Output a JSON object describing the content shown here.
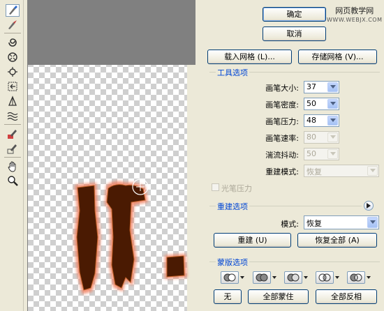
{
  "buttons": {
    "ok": "确定",
    "cancel": "取消",
    "load_mesh": "载入网格 (L)...",
    "save_mesh": "存储网格 (V)...",
    "reconstruct": "重建 (U)",
    "restore_all": "恢复全部 (A)",
    "none": "无",
    "mask_all": "全部蒙住",
    "invert_all": "全部反相"
  },
  "tool_options": {
    "title": "工具选项",
    "brush_size_label": "画笔大小:",
    "brush_size": "37",
    "brush_density_label": "画笔密度:",
    "brush_density": "50",
    "brush_pressure_label": "画笔压力:",
    "brush_pressure": "48",
    "brush_rate_label": "画笔速率:",
    "brush_rate": "80",
    "turbulent_jitter_label": "湍流抖动:",
    "turbulent_jitter": "50",
    "reconstruct_mode_label": "重建模式:",
    "reconstruct_mode": "恢复",
    "stylus_pressure_label": "光笔压力"
  },
  "reconstruct_options": {
    "title": "重建选项",
    "mode_label": "模式:",
    "mode": "恢复"
  },
  "mask_options": {
    "title": "蒙版选项"
  },
  "watermark": {
    "line1": "网页教学网",
    "line2": "WWW.WEBJX.COM"
  },
  "colors": {
    "glyph_fill": "#4a1a02",
    "glyph_glow": "#f08060",
    "accent_title": "#0046d5"
  }
}
